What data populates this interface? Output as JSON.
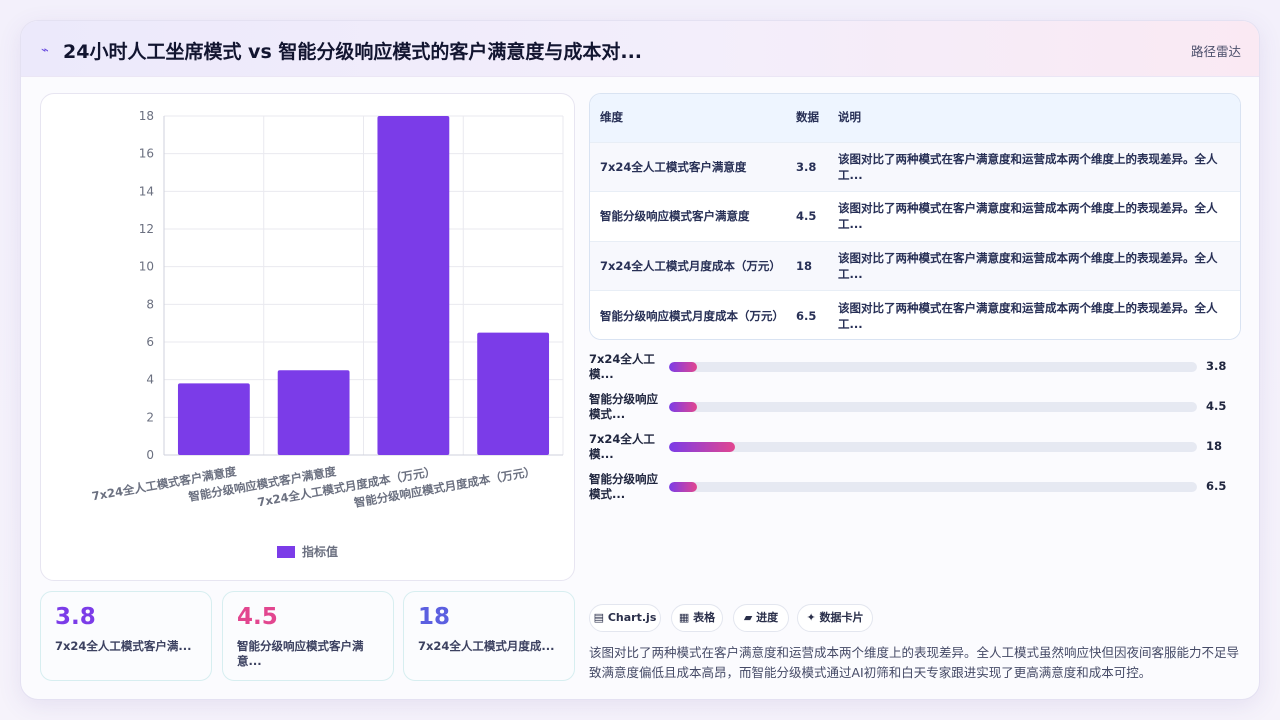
{
  "header": {
    "title": "24小时人工坐席模式 vs 智能分级响应模式的客户满意度与成本对...",
    "action": "路径雷达"
  },
  "colors": {
    "bar": "#7b3ce8",
    "kpi_values": [
      "#7b3ce8",
      "#e2468f",
      "#5b5fe0"
    ]
  },
  "chart_data": {
    "type": "bar",
    "categories": [
      "7x24全人工模式客户满意度",
      "智能分级响应模式客户满意度",
      "7x24全人工模式月度成本（万元）",
      "智能分级响应模式月度成本（万元）"
    ],
    "series": [
      {
        "name": "指标值",
        "values": [
          3.8,
          4.5,
          18,
          6.5
        ]
      }
    ],
    "ylim": [
      0,
      18
    ],
    "yticks": [
      "0",
      "2",
      "4",
      "6",
      "8",
      "10",
      "12",
      "14",
      "16",
      "18"
    ],
    "grid": true,
    "legend_position": "bottom"
  },
  "kpis": [
    {
      "value": "3.8",
      "label": "7x24全人工模式客户满..."
    },
    {
      "value": "4.5",
      "label": "智能分级响应模式客户满意..."
    },
    {
      "value": "18",
      "label": "7x24全人工模式月度成..."
    }
  ],
  "table": {
    "headers": [
      "维度",
      "数据",
      "说明"
    ],
    "rows": [
      {
        "dimension": "7x24全人工模式客户满意度",
        "value": "3.8",
        "note": "该图对比了两种模式在客户满意度和运营成本两个维度上的表现差异。全人工..."
      },
      {
        "dimension": "智能分级响应模式客户满意度",
        "value": "4.5",
        "note": "该图对比了两种模式在客户满意度和运营成本两个维度上的表现差异。全人工..."
      },
      {
        "dimension": "7x24全人工模式月度成本（万元）",
        "value": "18",
        "note": "该图对比了两种模式在客户满意度和运营成本两个维度上的表现差异。全人工..."
      },
      {
        "dimension": "智能分级响应模式月度成本（万元）",
        "value": "6.5",
        "note": "该图对比了两种模式在客户满意度和运营成本两个维度上的表现差异。全人工..."
      }
    ]
  },
  "progress": [
    {
      "label": "7x24全人工模...",
      "value": "3.8",
      "fraction": 0.053
    },
    {
      "label": "智能分级响应模式...",
      "value": "4.5",
      "fraction": 0.053
    },
    {
      "label": "7x24全人工模...",
      "value": "18",
      "fraction": 0.125
    },
    {
      "label": "智能分级响应模式...",
      "value": "6.5",
      "fraction": 0.053
    }
  ],
  "chips": [
    {
      "icon": "▤",
      "label": "Chart.js"
    },
    {
      "icon": "▦",
      "label": "表格"
    },
    {
      "icon": "▰",
      "label": "进度"
    },
    {
      "icon": "✦",
      "label": "数据卡片"
    }
  ],
  "summary": "该图对比了两种模式在客户满意度和运营成本两个维度上的表现差异。全人工模式虽然响应快但因夜间客服能力不足导致满意度偏低且成本高昂，而智能分级模式通过AI初筛和白天专家跟进实现了更高满意度和成本可控。"
}
